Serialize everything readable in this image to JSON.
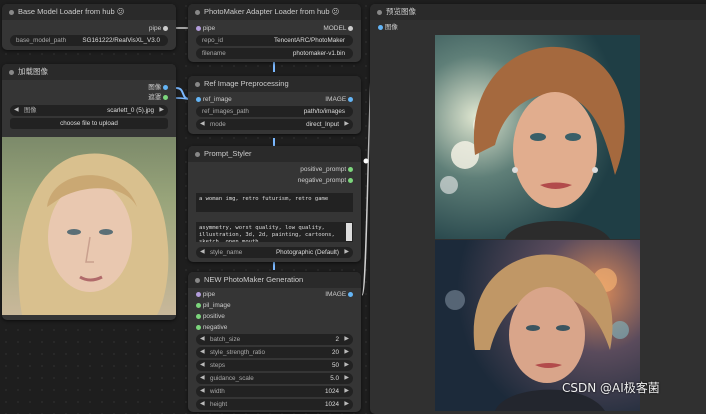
{
  "nodes": {
    "base_loader": {
      "title": "Base Model Loader from hub 😕",
      "out_pipe": "pipe",
      "widget_label": "base_model_path",
      "widget_value": "SG161222/RealVisXL_V3.0"
    },
    "adapter_loader": {
      "title": "PhotoMaker Adapter Loader from hub 😕",
      "in_pipe": "pipe",
      "out_model": "MODEL",
      "w1_label": "repo_id",
      "w1_value": "TencentARC/PhotoMaker",
      "w2_label": "filename",
      "w2_value": "photomaker-v1.bin"
    },
    "load_image": {
      "title": "加载图像",
      "out_image": "图像",
      "out_mask": "遮罩",
      "widget_label": "图像",
      "widget_value": "scarlett_0 (5).jpg",
      "button": "choose file to upload"
    },
    "ref_preproc": {
      "title": "Ref Image Preprocessing",
      "in_ref": "ref_image",
      "out_image": "IMAGE",
      "w1_label": "ref_images_path",
      "w1_value": "path/to/images",
      "w2_label": "mode",
      "w2_value": "direct_Input"
    },
    "prompt_styler": {
      "title": "Prompt_Styler",
      "out_pos": "positive_prompt",
      "out_neg": "negative_prompt",
      "pos_text": "a woman img, retro futurism, retro game",
      "neg_text": "asymmetry, worst quality, low quality, illustration, 3d, 2d, painting, cartoons, sketch, open mouth",
      "style_label": "style_name",
      "style_value": "Photographic (Default)"
    },
    "photomaker_gen": {
      "title": "NEW PhotoMaker Generation",
      "in_pipe": "pipe",
      "in_pil": "pil_image",
      "in_pos": "positive",
      "in_neg": "negative",
      "out_image": "IMAGE",
      "widgets": [
        {
          "label": "batch_size",
          "value": "2"
        },
        {
          "label": "style_strength_ratio",
          "value": "20"
        },
        {
          "label": "steps",
          "value": "50"
        },
        {
          "label": "guidance_scale",
          "value": "5.0"
        },
        {
          "label": "width",
          "value": "1024"
        },
        {
          "label": "height",
          "value": "1024"
        }
      ]
    },
    "preview": {
      "title": "预览图像",
      "in_image": "图像"
    }
  },
  "watermark": "CSDN @AI极客菌",
  "colors": {
    "image_socket": "#64b5f6",
    "model_socket": "#b39ddb",
    "pipe_socket": "#cccccc",
    "string_socket": "#7cd67c",
    "link_blue": "#7ab8ff"
  }
}
